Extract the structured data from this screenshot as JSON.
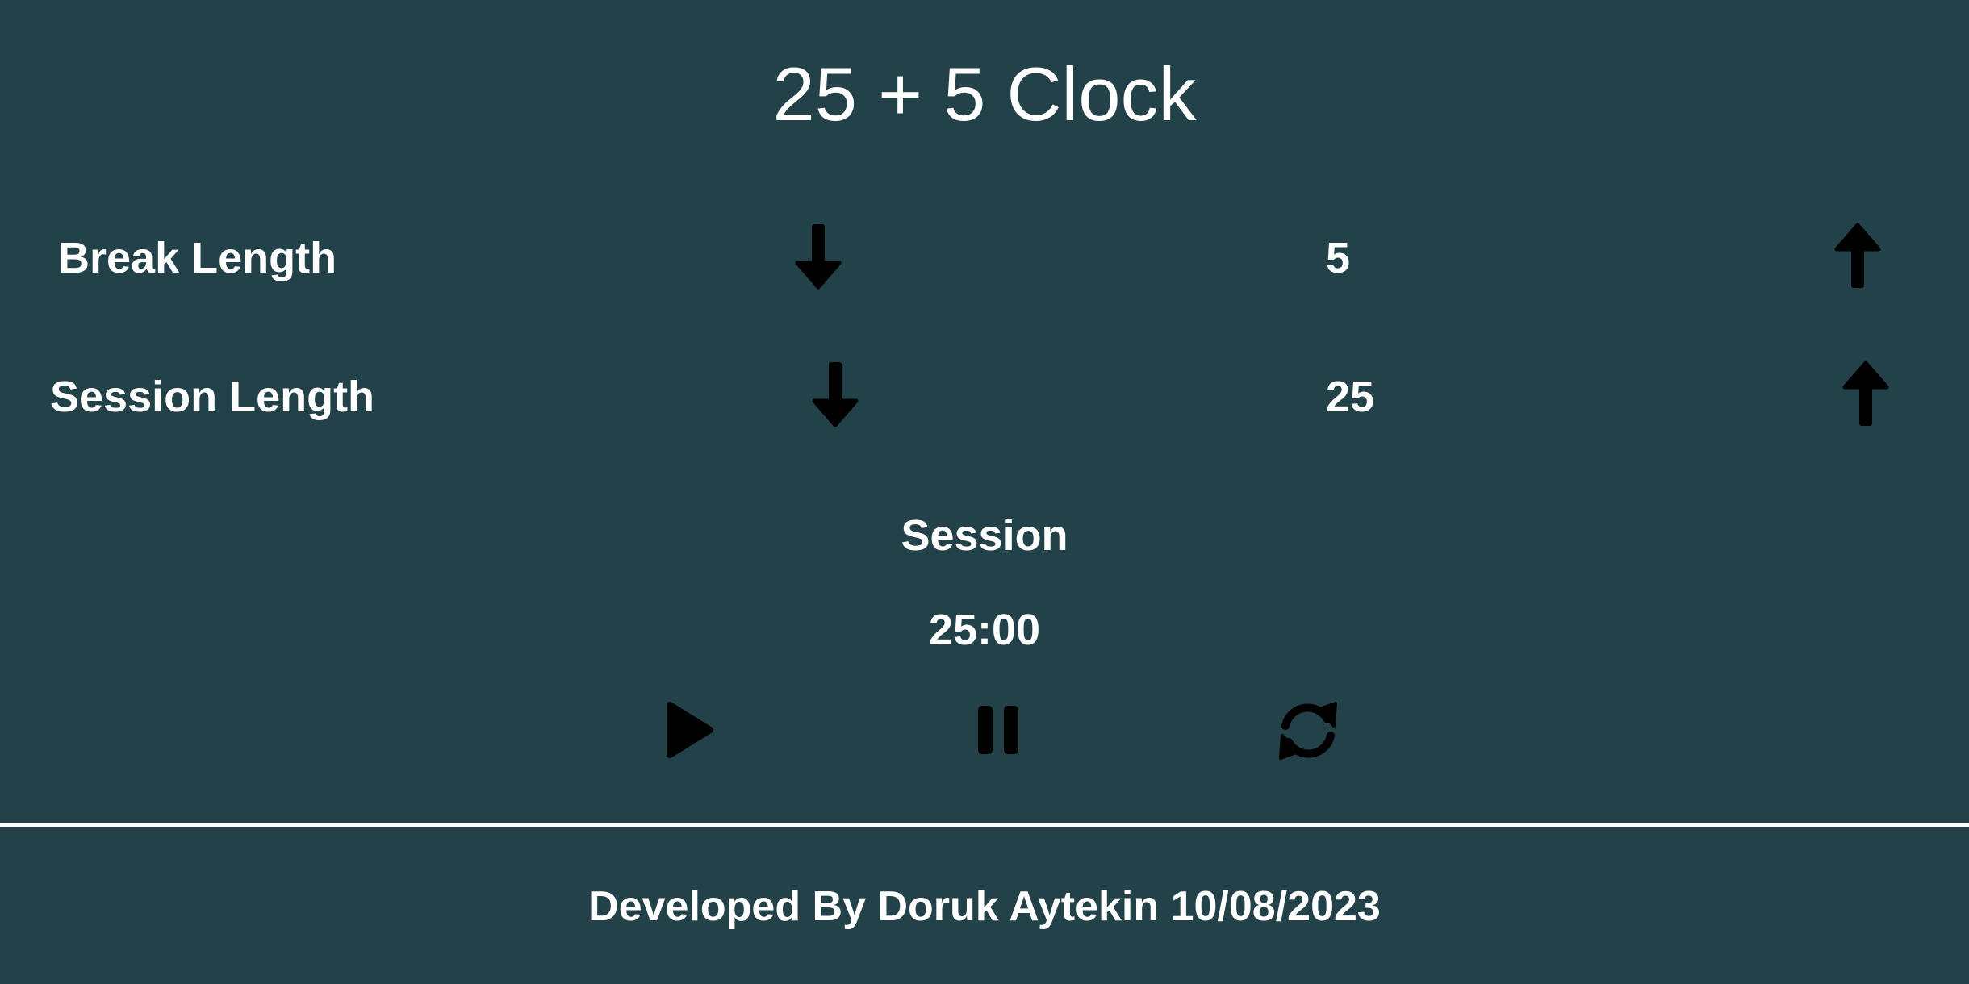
{
  "app": {
    "title": "25 + 5 Clock"
  },
  "break": {
    "label": "Break Length",
    "value": "5",
    "decrement_icon": "arrow-down-icon",
    "increment_icon": "arrow-up-icon"
  },
  "session": {
    "label": "Session Length",
    "value": "25",
    "decrement_icon": "arrow-down-icon",
    "increment_icon": "arrow-up-icon"
  },
  "timer": {
    "label": "Session",
    "time": "25:00"
  },
  "controls": {
    "play_icon": "play-icon",
    "pause_icon": "pause-icon",
    "reset_icon": "refresh-icon"
  },
  "footer": {
    "text": "Developed By Doruk Aytekin 10/08/2023"
  },
  "colors": {
    "background": "#234148",
    "text": "#ffffff",
    "icon": "#000000",
    "divider": "#ffffff"
  }
}
